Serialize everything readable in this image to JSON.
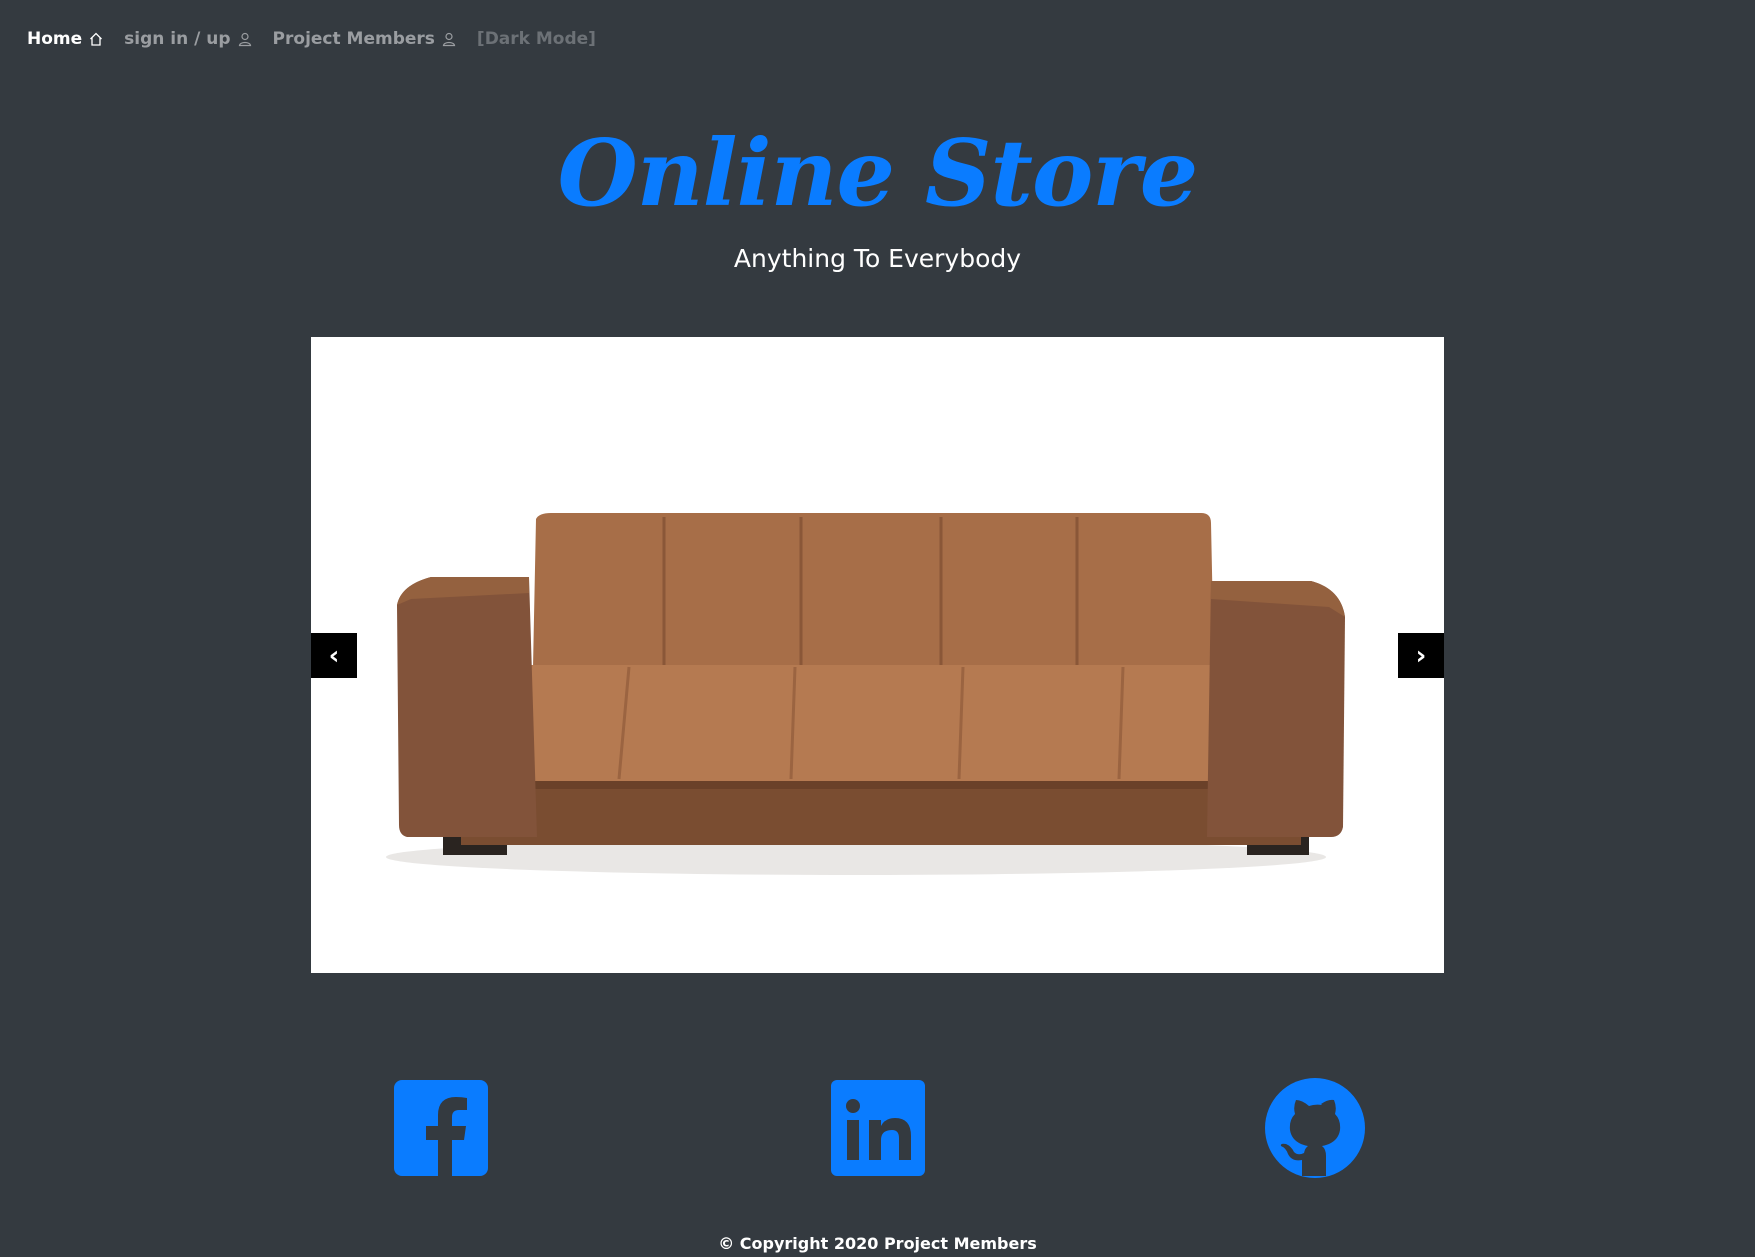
{
  "nav": {
    "home_label": "Home",
    "home_icon": "home-icon",
    "signin_label": "sign in / up",
    "signin_icon": "user-icon",
    "members_label": "Project Members",
    "members_icon": "user-icon",
    "darkmode_label": "[Dark Mode]"
  },
  "brand": {
    "title": "Online Store",
    "tagline": "Anything To Everybody",
    "accent_color": "#0a7cff"
  },
  "carousel": {
    "slide_image": "brown-sofa-photo",
    "prev_label": "‹",
    "next_label": "›",
    "prev_icon": "chevron-left-icon",
    "next_icon": "chevron-right-icon"
  },
  "socials": [
    {
      "name": "facebook",
      "icon": "facebook-icon"
    },
    {
      "name": "linkedin",
      "icon": "linkedin-icon"
    },
    {
      "name": "github",
      "icon": "github-icon"
    }
  ],
  "footer": {
    "copyright": "© Copyright 2020 Project Members"
  },
  "colors": {
    "background": "#343a40",
    "accent": "#0a7cff",
    "nav_active": "#ffffff",
    "nav_inactive": "#9a9da1"
  }
}
